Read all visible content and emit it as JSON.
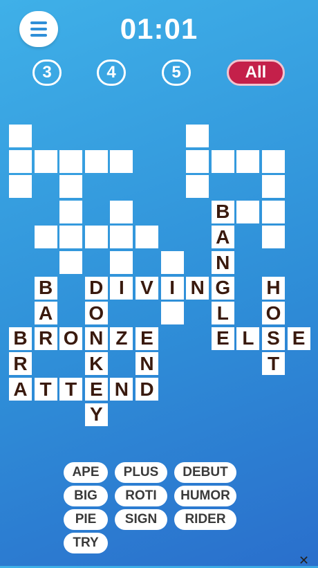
{
  "timer": "01:01",
  "filters": [
    "3",
    "4",
    "5",
    "All"
  ],
  "grid": [
    {
      "r": 0,
      "c": 0,
      "l": ""
    },
    {
      "r": 0,
      "c": 7,
      "l": ""
    },
    {
      "r": 1,
      "c": 0,
      "l": ""
    },
    {
      "r": 1,
      "c": 1,
      "l": ""
    },
    {
      "r": 1,
      "c": 2,
      "l": ""
    },
    {
      "r": 1,
      "c": 3,
      "l": ""
    },
    {
      "r": 1,
      "c": 4,
      "l": ""
    },
    {
      "r": 1,
      "c": 7,
      "l": ""
    },
    {
      "r": 1,
      "c": 8,
      "l": ""
    },
    {
      "r": 1,
      "c": 9,
      "l": ""
    },
    {
      "r": 1,
      "c": 10,
      "l": ""
    },
    {
      "r": 2,
      "c": 0,
      "l": ""
    },
    {
      "r": 2,
      "c": 2,
      "l": ""
    },
    {
      "r": 2,
      "c": 7,
      "l": ""
    },
    {
      "r": 2,
      "c": 10,
      "l": ""
    },
    {
      "r": 3,
      "c": 2,
      "l": ""
    },
    {
      "r": 3,
      "c": 4,
      "l": ""
    },
    {
      "r": 3,
      "c": 8,
      "l": "B"
    },
    {
      "r": 3,
      "c": 9,
      "l": ""
    },
    {
      "r": 3,
      "c": 10,
      "l": ""
    },
    {
      "r": 4,
      "c": 1,
      "l": ""
    },
    {
      "r": 4,
      "c": 2,
      "l": ""
    },
    {
      "r": 4,
      "c": 3,
      "l": ""
    },
    {
      "r": 4,
      "c": 4,
      "l": ""
    },
    {
      "r": 4,
      "c": 5,
      "l": ""
    },
    {
      "r": 4,
      "c": 8,
      "l": "A"
    },
    {
      "r": 4,
      "c": 10,
      "l": ""
    },
    {
      "r": 5,
      "c": 2,
      "l": ""
    },
    {
      "r": 5,
      "c": 4,
      "l": ""
    },
    {
      "r": 5,
      "c": 6,
      "l": ""
    },
    {
      "r": 5,
      "c": 8,
      "l": "N"
    },
    {
      "r": 6,
      "c": 1,
      "l": "B"
    },
    {
      "r": 6,
      "c": 3,
      "l": "D"
    },
    {
      "r": 6,
      "c": 4,
      "l": "I"
    },
    {
      "r": 6,
      "c": 5,
      "l": "V"
    },
    {
      "r": 6,
      "c": 6,
      "l": "I"
    },
    {
      "r": 6,
      "c": 7,
      "l": "N"
    },
    {
      "r": 6,
      "c": 8,
      "l": "G"
    },
    {
      "r": 6,
      "c": 10,
      "l": "H"
    },
    {
      "r": 7,
      "c": 1,
      "l": "A"
    },
    {
      "r": 7,
      "c": 3,
      "l": "O"
    },
    {
      "r": 7,
      "c": 6,
      "l": ""
    },
    {
      "r": 7,
      "c": 8,
      "l": "L"
    },
    {
      "r": 7,
      "c": 10,
      "l": "O"
    },
    {
      "r": 8,
      "c": 0,
      "l": "B"
    },
    {
      "r": 8,
      "c": 1,
      "l": "R"
    },
    {
      "r": 8,
      "c": 2,
      "l": "O"
    },
    {
      "r": 8,
      "c": 3,
      "l": "N"
    },
    {
      "r": 8,
      "c": 4,
      "l": "Z"
    },
    {
      "r": 8,
      "c": 5,
      "l": "E"
    },
    {
      "r": 8,
      "c": 8,
      "l": "E"
    },
    {
      "r": 8,
      "c": 9,
      "l": "L"
    },
    {
      "r": 8,
      "c": 10,
      "l": "S"
    },
    {
      "r": 8,
      "c": 11,
      "l": "E"
    },
    {
      "r": 9,
      "c": 0,
      "l": "R"
    },
    {
      "r": 9,
      "c": 3,
      "l": "K"
    },
    {
      "r": 9,
      "c": 5,
      "l": "N"
    },
    {
      "r": 9,
      "c": 10,
      "l": "T"
    },
    {
      "r": 10,
      "c": 0,
      "l": "A"
    },
    {
      "r": 10,
      "c": 1,
      "l": "T"
    },
    {
      "r": 10,
      "c": 2,
      "l": "T"
    },
    {
      "r": 10,
      "c": 3,
      "l": "E"
    },
    {
      "r": 10,
      "c": 4,
      "l": "N"
    },
    {
      "r": 10,
      "c": 5,
      "l": "D"
    },
    {
      "r": 11,
      "c": 3,
      "l": "Y"
    }
  ],
  "words": [
    "APE",
    "PLUS",
    "DEBUT",
    "BIG",
    "ROTI",
    "HUMOR",
    "PIE",
    "SIGN",
    "RIDER",
    "TRY"
  ],
  "close_glyph": "✕"
}
